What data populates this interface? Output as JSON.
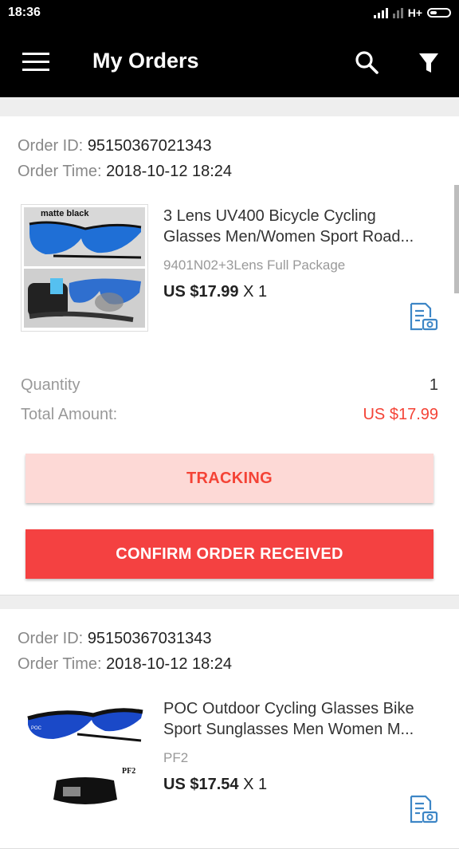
{
  "status_bar": {
    "time": "18:36",
    "network": "H+"
  },
  "app_bar": {
    "title": "My Orders"
  },
  "orders": [
    {
      "id_label": "Order ID:",
      "id": "95150367021343",
      "time_label": "Order Time:",
      "time": "2018-10-12 18:24",
      "thumb_text": "matte black",
      "title_line1": "3 Lens UV400 Bicycle Cycling",
      "title_line2": "Glasses Men/Women Sport Road...",
      "variant": "9401N02+3Lens Full Package",
      "price": "US $17.99",
      "qty_suffix": "X 1",
      "quantity_label": "Quantity",
      "quantity": "1",
      "total_label": "Total Amount:",
      "total": "US $17.99",
      "tracking_label": "TRACKING",
      "confirm_label": "CONFIRM ORDER RECEIVED"
    },
    {
      "id_label": "Order ID:",
      "id": "95150367031343",
      "time_label": "Order Time:",
      "time": "2018-10-12 18:24",
      "thumb_text": "PF2",
      "title_line1": "POC Outdoor Cycling Glasses Bike",
      "title_line2": "Sport Sunglasses Men Women M...",
      "variant": "PF2",
      "price": "US $17.54",
      "qty_suffix": "X 1"
    }
  ],
  "icons": {
    "menu": "menu-icon",
    "search": "search-icon",
    "filter": "filter-icon",
    "evidence": "document-camera-icon"
  },
  "colors": {
    "accent": "#f44336",
    "tracking_bg": "#fdd9d6",
    "confirm_bg": "#f44141",
    "icon_blue": "#3d86c6"
  }
}
